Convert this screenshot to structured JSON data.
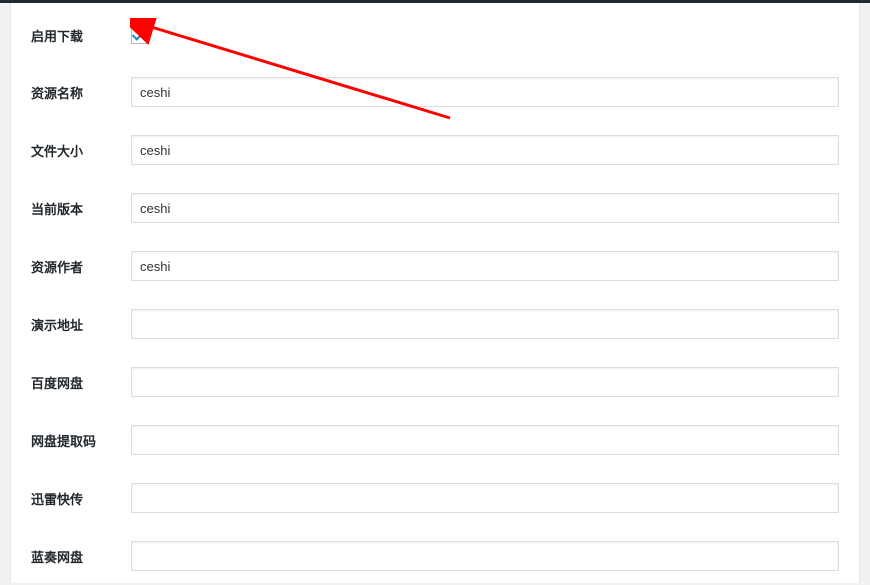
{
  "form": {
    "enable_download": {
      "label": "启用下载",
      "checked": true
    },
    "resource_name": {
      "label": "资源名称",
      "value": "ceshi"
    },
    "file_size": {
      "label": "文件大小",
      "value": "ceshi"
    },
    "current_version": {
      "label": "当前版本",
      "value": "ceshi"
    },
    "resource_author": {
      "label": "资源作者",
      "value": "ceshi"
    },
    "demo_url": {
      "label": "演示地址",
      "value": ""
    },
    "baidu_pan": {
      "label": "百度网盘",
      "value": ""
    },
    "pan_code": {
      "label": "网盘提取码",
      "value": ""
    },
    "xunlei": {
      "label": "迅雷快传",
      "value": ""
    },
    "lanzou": {
      "label": "蓝奏网盘",
      "value": ""
    }
  },
  "annotation": {
    "arrow_color": "#ff0000"
  }
}
